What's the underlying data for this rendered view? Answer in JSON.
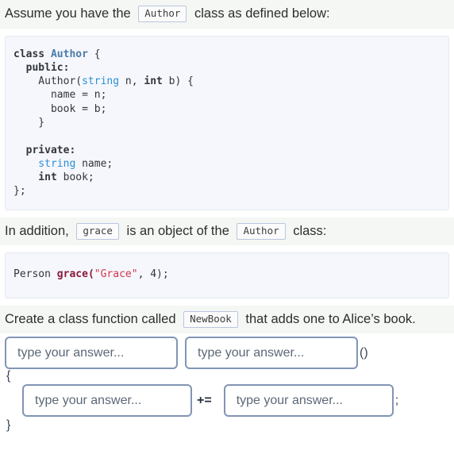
{
  "intro": {
    "before": "Assume you have the ",
    "code_badge": "Author",
    "after": " class as defined below:"
  },
  "class_code": {
    "l1_kw": "class",
    "l1_name": "Author",
    "l1_brace": " {",
    "l2": "  public:",
    "l3_fn": "    Author(",
    "l3_type1": "string",
    "l3_mid": " n, ",
    "l3_type2": "int",
    "l3_end": " b) {",
    "l4": "      name = n;",
    "l5": "      book = b;",
    "l6": "    }",
    "l7_blank": "",
    "l8": "  private:",
    "l9_type": "    string",
    "l9_rest": " name;",
    "l10_type": "    int",
    "l10_rest": " book;",
    "l11": "};"
  },
  "addition": {
    "before": "In addition, ",
    "code_badge_1": "grace",
    "middle": " is an object of the ",
    "code_badge_2": "Author",
    "after": " class:"
  },
  "object_code": {
    "type": "Person",
    "var": " grace",
    "open": "(",
    "str": "\"Grace\"",
    "rest": ", 4);"
  },
  "task": {
    "before": "Create a class function called ",
    "code_badge": "NewBook",
    "after": " that adds one to Alice’s book."
  },
  "answer": {
    "input1_placeholder": "type your answer...",
    "input2_placeholder": "type your answer...",
    "parens": "()",
    "brace_open": "{",
    "input3_placeholder": "type your answer...",
    "operator": "+=",
    "input4_placeholder": "type your answer...",
    "semicolon": ";",
    "brace_close": "}"
  },
  "colors": {
    "prose_bg": "#f4f7f3",
    "code_bg": "#f5f7fc",
    "code_border": "#e4e8f2",
    "input_border": "#8295b5",
    "badge_border": "#b9c6dd",
    "keyword": "#32363b",
    "type_blue": "#2b8fd4",
    "class_blue": "#4b7ba8",
    "var_maroon": "#8b1a3a",
    "string_red": "#d6344e"
  }
}
